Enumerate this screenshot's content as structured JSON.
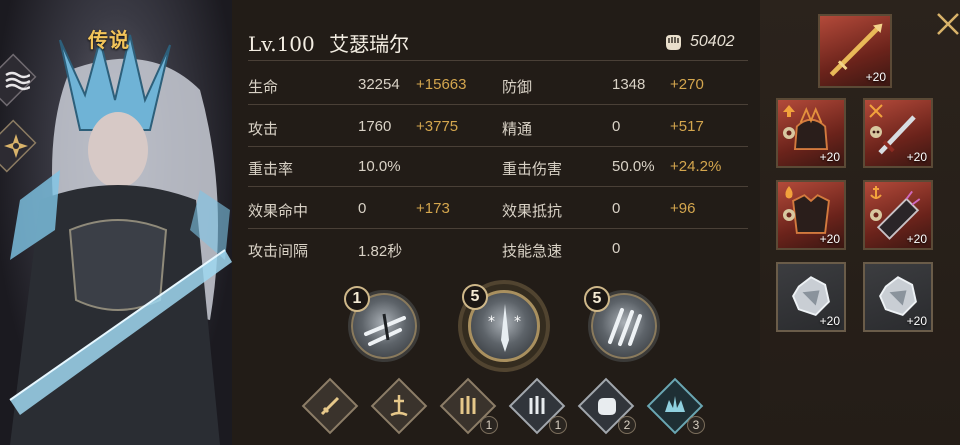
{
  "hero": {
    "rarity": "传说",
    "level": "Lv.100",
    "name": "艾瑟瑞尔",
    "power": "50402"
  },
  "stats": [
    {
      "label": "生命",
      "value": "32254",
      "bonus": "+15663"
    },
    {
      "label": "防御",
      "value": "1348",
      "bonus": "+270"
    },
    {
      "label": "攻击",
      "value": "1760",
      "bonus": "+3775"
    },
    {
      "label": "精通",
      "value": "0",
      "bonus": "+517"
    },
    {
      "label": "重击率",
      "value": "10.0%",
      "bonus": ""
    },
    {
      "label": "重击伤害",
      "value": "50.0%",
      "bonus": "+24.2%"
    },
    {
      "label": "效果命中",
      "value": "0",
      "bonus": "+173"
    },
    {
      "label": "效果抵抗",
      "value": "0",
      "bonus": "+96"
    },
    {
      "label": "攻击间隔",
      "value": "1.82秒",
      "bonus": ""
    },
    {
      "label": "技能急速",
      "value": "0",
      "bonus": ""
    }
  ],
  "skills": [
    {
      "level": "1",
      "icon": "chain-blade-skill-icon"
    },
    {
      "level": "5",
      "icon": "ice-sword-skill-icon"
    },
    {
      "level": "5",
      "icon": "frost-claw-skill-icon"
    }
  ],
  "traits": [
    {
      "icon": "sword-icon",
      "count": ""
    },
    {
      "icon": "pedestal-sword-icon",
      "count": ""
    },
    {
      "icon": "triple-blades-icon",
      "count": "1"
    },
    {
      "icon": "triple-swords-icon",
      "count": "1"
    },
    {
      "icon": "fist-icon",
      "count": "2"
    },
    {
      "icon": "ice-crown-icon",
      "count": "3"
    }
  ],
  "equipment": [
    {
      "slot": "weapon",
      "enhance": "+20"
    },
    {
      "slot": "helmet",
      "enhance": "+20"
    },
    {
      "slot": "dagger",
      "enhance": "+20"
    },
    {
      "slot": "armor",
      "enhance": "+20"
    },
    {
      "slot": "gauntlet",
      "enhance": "+20"
    },
    {
      "slot": "gem-1",
      "enhance": "+20"
    },
    {
      "slot": "gem-2",
      "enhance": "+20"
    }
  ],
  "colors": {
    "accent_gold": "#d4a64e",
    "rarity_gold": "#f2c45a",
    "equip_red": "#b34a3a"
  }
}
